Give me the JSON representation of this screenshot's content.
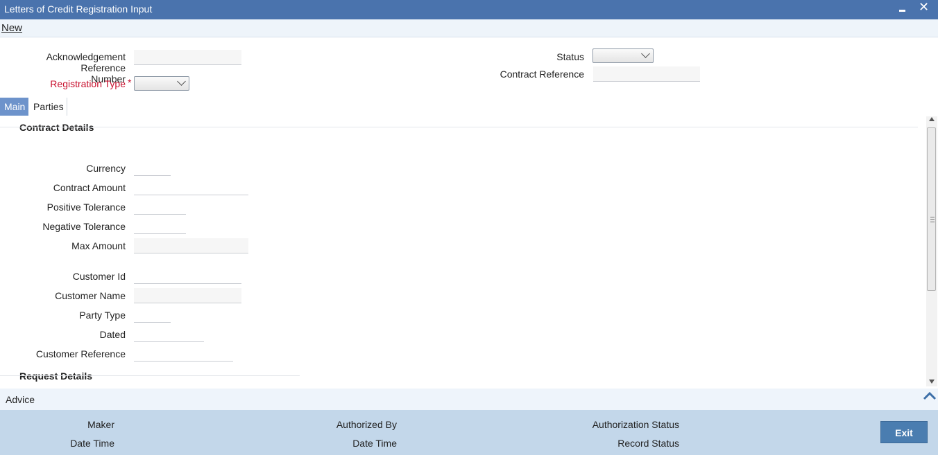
{
  "window": {
    "title": "Letters of Credit Registration Input",
    "minimize_icon": "minimize-icon",
    "close_icon": "close-icon",
    "close_glyph": "✕"
  },
  "menu": {
    "new_label": "New"
  },
  "header": {
    "ack_ref_label_line1": "Acknowledgement Reference",
    "ack_ref_label_line2": "Number",
    "ack_ref_value": "",
    "registration_type_label": "Registration Type",
    "required_mark": "*",
    "registration_type_value": "",
    "status_label": "Status",
    "status_value": "",
    "contract_reference_label": "Contract Reference",
    "contract_reference_value": ""
  },
  "tabs": [
    {
      "label": "Main",
      "active": true
    },
    {
      "label": "Parties",
      "active": false
    }
  ],
  "contract_details": {
    "title": "Contract Details",
    "fields": {
      "currency": {
        "label": "Currency",
        "value": ""
      },
      "contract_amount": {
        "label": "Contract Amount",
        "value": ""
      },
      "positive_tolerance": {
        "label": "Positive Tolerance",
        "value": ""
      },
      "negative_tolerance": {
        "label": "Negative Tolerance",
        "value": ""
      },
      "max_amount": {
        "label": "Max Amount",
        "value": ""
      },
      "customer_id": {
        "label": "Customer Id",
        "value": ""
      },
      "customer_name": {
        "label": "Customer Name",
        "value": ""
      },
      "party_type": {
        "label": "Party Type",
        "value": ""
      },
      "dated": {
        "label": "Dated",
        "value": ""
      },
      "customer_reference": {
        "label": "Customer Reference",
        "value": ""
      }
    }
  },
  "request_details": {
    "title": "Request Details"
  },
  "advice": {
    "label": "Advice"
  },
  "footer": {
    "maker_label": "Maker",
    "maker_date_time_label": "Date Time",
    "authorized_by_label": "Authorized By",
    "auth_date_time_label": "Date Time",
    "authorization_status_label": "Authorization Status",
    "record_status_label": "Record Status",
    "exit_label": "Exit"
  },
  "colors": {
    "title_bar": "#4a73ad",
    "active_tab": "#6d93cb",
    "footer": "#c3d7ea",
    "exit_button": "#4a7db0",
    "required_label": "#c8102e"
  }
}
